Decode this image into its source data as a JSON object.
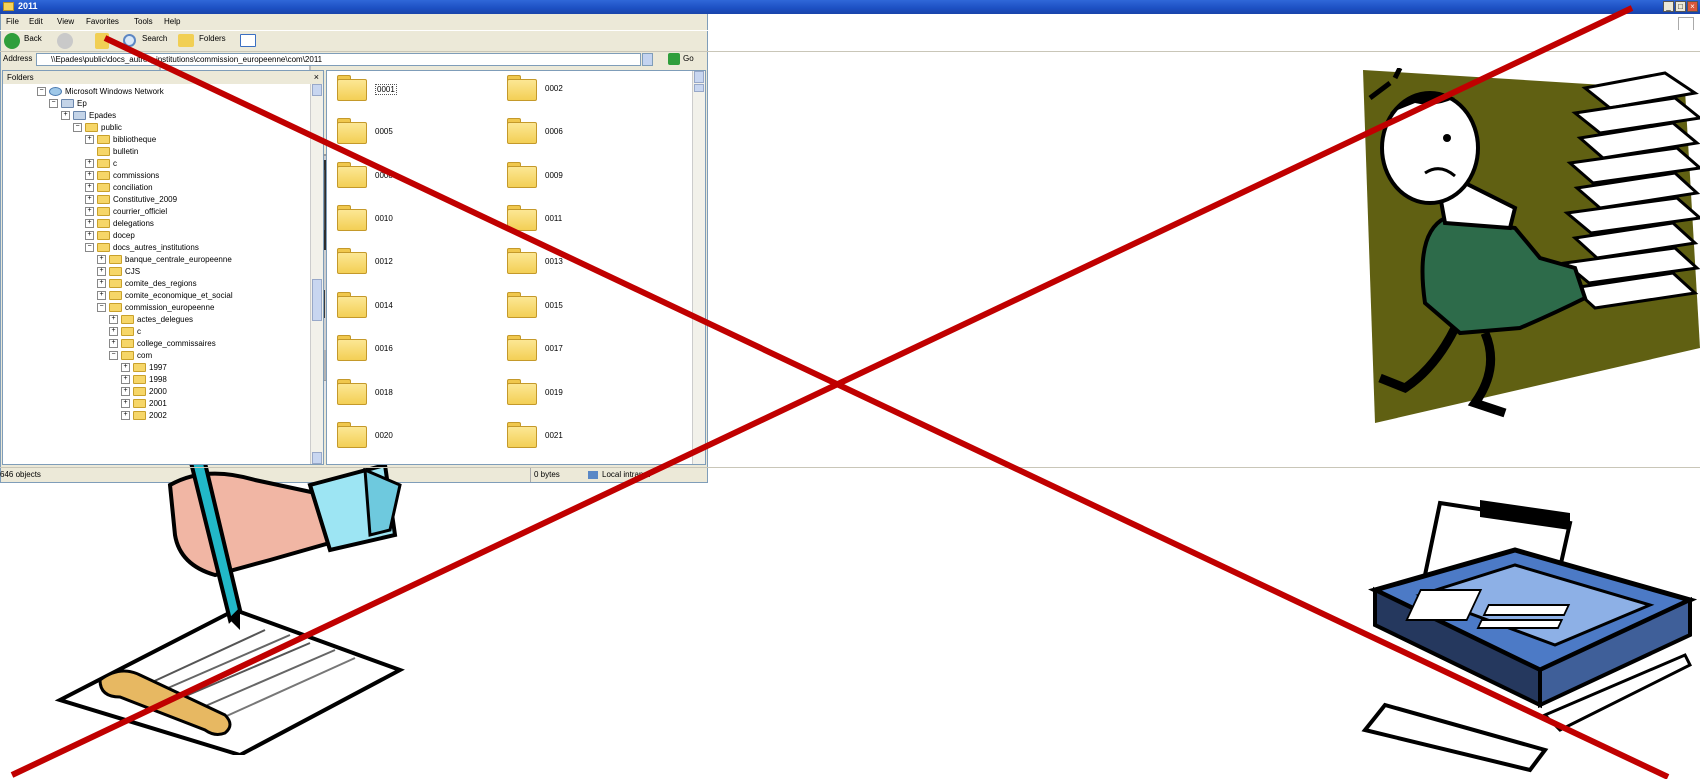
{
  "window": {
    "title": "2011",
    "menu": [
      "File",
      "Edit",
      "View",
      "Favorites",
      "Tools",
      "Help"
    ],
    "toolbar": {
      "back": "Back",
      "search": "Search",
      "folders": "Folders"
    },
    "address_label": "Address",
    "address_value": "\\\\Epades\\public\\docs_autres_institutions\\commission_europeenne\\com\\2011",
    "go_label": "Go",
    "pane_title": "Folders",
    "pane_close": "×",
    "tree": [
      "Microsoft Windows Network",
      "Ep",
      "Epades",
      "public",
      "bibliotheque",
      "bulletin",
      "c",
      "commissions",
      "conciliation",
      "Constitutive_2009",
      "courrier_officiel",
      "delegations",
      "docep",
      "docs_autres_institutions",
      "banque_centrale_europeenne",
      "CJS",
      "comite_des_regions",
      "comite_economique_et_social",
      "commission_europeenne",
      "actes_delegues",
      "c",
      "college_commissaires",
      "com",
      "1997",
      "1998",
      "2000",
      "2001",
      "2002"
    ],
    "folders": [
      "0001",
      "0002",
      "0005",
      "0006",
      "0008",
      "0009",
      "0010",
      "0011",
      "0012",
      "0013",
      "0014",
      "0015",
      "0016",
      "0017",
      "0018",
      "0019",
      "0020",
      "0021"
    ],
    "status": {
      "objects": "646 objects",
      "size": "0 bytes",
      "zone": "Local intranet"
    }
  },
  "colors": {
    "cross": "#c00000",
    "titlebar": "#1c4fc2",
    "poster_bg": "#606012"
  },
  "icons": [
    "printer-icon",
    "signature-hand-icon",
    "busy-man-with-papers-icon",
    "fax-machine-icon"
  ]
}
